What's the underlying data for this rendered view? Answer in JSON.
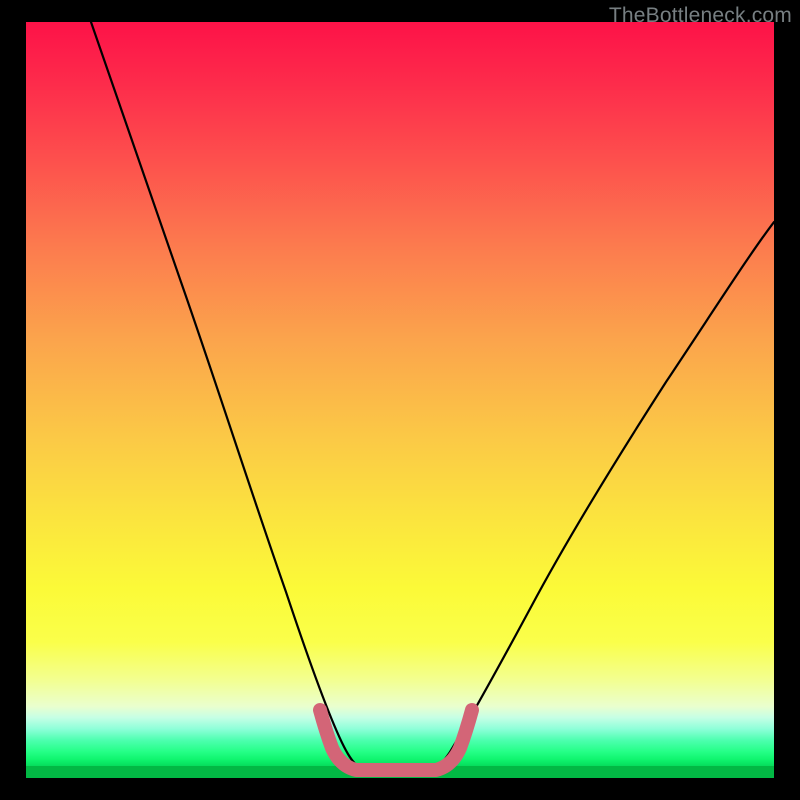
{
  "watermark": "TheBottleneck.com",
  "chart_data": {
    "type": "line",
    "title": "",
    "xlabel": "",
    "ylabel": "",
    "xlim": [
      0,
      100
    ],
    "ylim": [
      0,
      100
    ],
    "series": [
      {
        "name": "bottleneck-curve",
        "x": [
          0,
          5,
          10,
          15,
          20,
          25,
          30,
          35,
          40,
          42,
          46,
          50,
          54,
          56,
          60,
          65,
          70,
          75,
          80,
          85,
          90,
          95,
          100
        ],
        "values": [
          100,
          90,
          80,
          69,
          58,
          46,
          33,
          19,
          5,
          1,
          0,
          0,
          0,
          1,
          5,
          13,
          22,
          30,
          38,
          45,
          52,
          58,
          63
        ]
      }
    ],
    "annotations": [
      {
        "name": "valley-highlight",
        "x_range": [
          40,
          56
        ],
        "color": "#d36577"
      }
    ],
    "background_gradient": {
      "stops": [
        {
          "pos": 0,
          "color": "#fd1248"
        },
        {
          "pos": 50,
          "color": "#fbc946"
        },
        {
          "pos": 75,
          "color": "#fbfa38"
        },
        {
          "pos": 100,
          "color": "#02b844"
        }
      ]
    }
  }
}
